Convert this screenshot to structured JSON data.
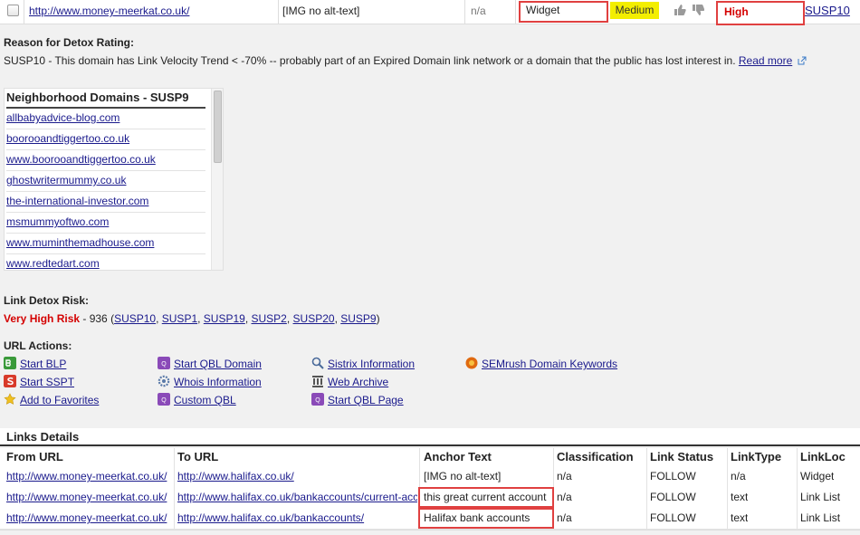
{
  "top_row": {
    "url": "http://www.money-meerkat.co.uk/",
    "anchor_text": "[IMG no alt-text]",
    "na": "n/a",
    "type": "Widget",
    "priority": "Medium",
    "risk": "High",
    "rule": "SUSP10"
  },
  "reason": {
    "title": "Reason for Detox Rating:",
    "text": "SUSP10 - This domain has Link Velocity Trend < -70% -- probably part of an Expired Domain link network or a domain that the public has lost interest in.",
    "read_more": "Read more"
  },
  "neighborhood": {
    "title": "Neighborhood Domains - SUSP9",
    "domains": [
      "allbabyadvice-blog.com",
      "boorooandtiggertoo.co.uk",
      "www.boorooandtiggertoo.co.uk",
      "ghostwritermummy.co.uk",
      "the-international-investor.com",
      "msmummyoftwo.com",
      "www.muminthemadhouse.com",
      "www.redtedart.com"
    ]
  },
  "detox_risk": {
    "title": "Link Detox Risk:",
    "level": "Very High Risk",
    "score_text": " - 936 (",
    "rules": [
      "SUSP10",
      "SUSP1",
      "SUSP19",
      "SUSP2",
      "SUSP20",
      "SUSP9"
    ],
    "close": ")"
  },
  "url_actions": {
    "title": "URL Actions:",
    "items": [
      {
        "label": "Start BLP",
        "icon": "blp-icon",
        "color": "#3a9a3a"
      },
      {
        "label": "Start SSPT",
        "icon": "sspt-icon",
        "color": "#d83a2a"
      },
      {
        "label": "Add to Favorites",
        "icon": "star-icon",
        "color": "#f0c020"
      },
      {
        "label": "Start QBL Domain",
        "icon": "qbl-icon",
        "color": "#8a4ab8"
      },
      {
        "label": "Whois Information",
        "icon": "gear-icon",
        "color": "#5a7aa8"
      },
      {
        "label": "Custom QBL",
        "icon": "qbl-icon",
        "color": "#8a4ab8"
      },
      {
        "label": "Sistrix Information",
        "icon": "search-icon",
        "color": "#4a6a9a"
      },
      {
        "label": "Web Archive",
        "icon": "archive-icon",
        "color": "#555555"
      },
      {
        "label": "Start QBL Page",
        "icon": "qbl-icon",
        "color": "#8a4ab8"
      },
      {
        "label": "SEMrush Domain Keywords",
        "icon": "semrush-icon",
        "color": "#e06a10"
      }
    ]
  },
  "links_details": {
    "title": "Links Details",
    "headers": [
      "From URL",
      "To URL",
      "Anchor Text",
      "Classification",
      "Link Status",
      "LinkType",
      "LinkLoc"
    ],
    "rows": [
      [
        "http://www.money-meerkat.co.uk/",
        "http://www.halifax.co.uk/",
        "[IMG no alt-text]",
        "n/a",
        "FOLLOW",
        "n/a",
        "Widget"
      ],
      [
        "http://www.money-meerkat.co.uk/",
        "http://www.halifax.co.uk/bankaccounts/current-accounts/",
        "this great current account",
        "n/a",
        "FOLLOW",
        "text",
        "Link List"
      ],
      [
        "http://www.money-meerkat.co.uk/",
        "http://www.halifax.co.uk/bankaccounts/",
        "Halifax bank accounts",
        "n/a",
        "FOLLOW",
        "text",
        "Link List"
      ]
    ]
  },
  "colors": {
    "highlight": "#e04040",
    "medium": "#f3ee00",
    "risk_red": "#d40000",
    "link": "#1a1a8c"
  }
}
